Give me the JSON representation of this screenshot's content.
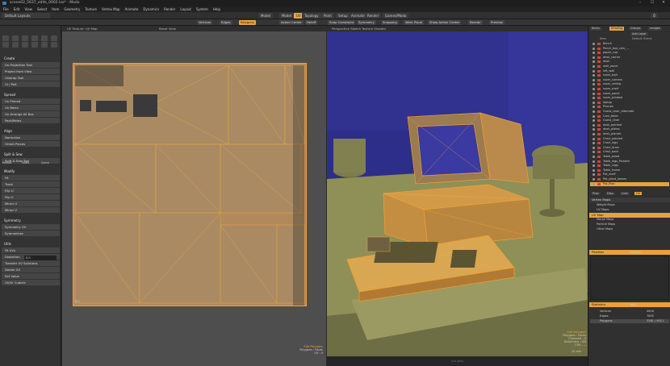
{
  "window": {
    "title": "scene02_5637_edits_0002.lxo* - Modo",
    "controls": [
      "–",
      "☐",
      "✕"
    ]
  },
  "menubar": [
    "File",
    "Edit",
    "View",
    "Select",
    "Item",
    "Geometry",
    "Texture",
    "Vertex Map",
    "Animate",
    "Dynamics",
    "Render",
    "Layout",
    "System",
    "Help"
  ],
  "layout_dropdown": "Default Layouts",
  "tabs": [
    {
      "label": "Model",
      "active": false
    },
    {
      "label": "Model",
      "active": false
    },
    {
      "label": "UV",
      "active": true
    },
    {
      "label": "Topology",
      "active": false
    },
    {
      "label": "Paint",
      "active": false
    },
    {
      "label": "Setup",
      "active": false
    },
    {
      "label": "Animate",
      "active": false
    },
    {
      "label": "Render",
      "active": false
    },
    {
      "label": "Games/Modo",
      "active": false
    }
  ],
  "tabbar_right": "Ô",
  "toolbar": [
    {
      "label": "Vertices",
      "on": false
    },
    {
      "label": "Edges",
      "on": false
    },
    {
      "label": "Polygons",
      "on": true
    },
    {
      "label": "Action Center",
      "on": false
    },
    {
      "label": "Falloff",
      "on": false
    },
    {
      "label": "Snap Constraint",
      "on": false
    },
    {
      "label": "Symmetry",
      "on": false
    },
    {
      "label": "Snapping",
      "on": false
    },
    {
      "label": "Work Plane",
      "on": false
    },
    {
      "label": "Show Action Center",
      "on": false
    },
    {
      "label": "Render",
      "on": false
    },
    {
      "label": "Preview",
      "on": false
    }
  ],
  "left_panel": {
    "sections": [
      {
        "title": "Create",
        "items": [
          "Un-Projection Tool",
          "Project from View",
          "Unwrap Tool",
          "Ui / Pelt"
        ]
      },
      {
        "title": "Spread",
        "items": [
          "Un Pinned",
          "Un Relax",
          "Un Arrange All Box",
          "Pack/Relax"
        ]
      },
      {
        "title": "Align",
        "items": [
          "Normalize",
          "Orient Pieces"
        ]
      },
      {
        "title": "Split & Sew",
        "items": [
          "Split & Sew Tool"
        ]
      },
      {
        "title": "Modify",
        "items": [
          "Fit",
          "Track",
          "Flip U",
          "Flip V",
          "Mirror U",
          "Mirror V"
        ]
      },
      {
        "title": "Symmetry",
        "items": [
          "Symmetry UV",
          "Symmetrize"
        ]
      },
      {
        "title": "Utils",
        "items": [
          "Fit UVs",
          "Distortion",
          "Transfer UV Solutions",
          "Delete UV",
          "Set Value",
          "UV/Ui Cubicle"
        ]
      }
    ],
    "checkboxes": [
      "Pocket",
      "Seals",
      "Quick"
    ],
    "transfer_value": "0.0"
  },
  "uv_view": {
    "header": "UV Texture: UV Map",
    "header_right": "Reset View",
    "overlay": [
      "Edit Polygons",
      "Polygons : Faces",
      "UV : 0"
    ],
    "corner_label": "0.0"
  },
  "view3d": {
    "header": "Perspective    Sketch Texture Shaded",
    "overlay": [
      "Edit Polygons",
      "Polygons : Faces",
      "Channels : 0",
      "Deformers : ON",
      "CPU : ..."
    ],
    "scale": "25 mm"
  },
  "right_panel": {
    "tabs": [
      "Items",
      "Shading",
      "Groups",
      "Images"
    ],
    "filter_label": "Add Layer",
    "column_headers": [
      "Item",
      "Default Scene"
    ],
    "items": [
      "Bench",
      "Pencil_box_rain_...",
      "paper_cup",
      "desk_corner",
      "desk",
      "wall_panel",
      "left_wall",
      "room_wall",
      "room_corners",
      "room_ceiling",
      "room_shelf",
      "room_panel",
      "room_window",
      "laptop",
      "Phones",
      "Guest_chair_alternate",
      "Cam_table",
      "Guest_chair",
      "desk_painted",
      "desk_plates",
      "desk_planter",
      "Chair_painted",
      "Chair_legs",
      "Chair_Arms",
      "Chair_back",
      "Table_wood",
      "Table_legs_Painted",
      "Table_Legs",
      "Table_frame",
      "Pot_shelf",
      "Pot_plant_leaves",
      "Pot_Plan"
    ],
    "selected_item": "Pot_Plan",
    "properties_tabs": [
      "Prop",
      "Disp",
      "Lists",
      "UV"
    ],
    "vmap_section": "Vertex Maps",
    "vmap_items": [
      "Weight Maps",
      "UV Maps",
      "Morph Maps",
      "Particle Maps",
      "Other Maps"
    ],
    "uv_section": "UV Map",
    "palettes_title": "Palettes",
    "palettes_tab": "Frames",
    "stats_title": "Statistics",
    "stats_tab": "Info",
    "stats_rows": [
      {
        "name": "Vertices",
        "value": "4618"
      },
      {
        "name": "Edges",
        "value": "7895"
      },
      {
        "name": "Polygons",
        "value": "3281 / 9011"
      }
    ]
  },
  "statusbar": "(no info)",
  "colors": {
    "accent": "#e8a23c",
    "uv_fill": "#b08a5c",
    "wire": "#f0a030",
    "scene_blue": "#2d2d8a",
    "scene_olive": "#8f8f58"
  }
}
